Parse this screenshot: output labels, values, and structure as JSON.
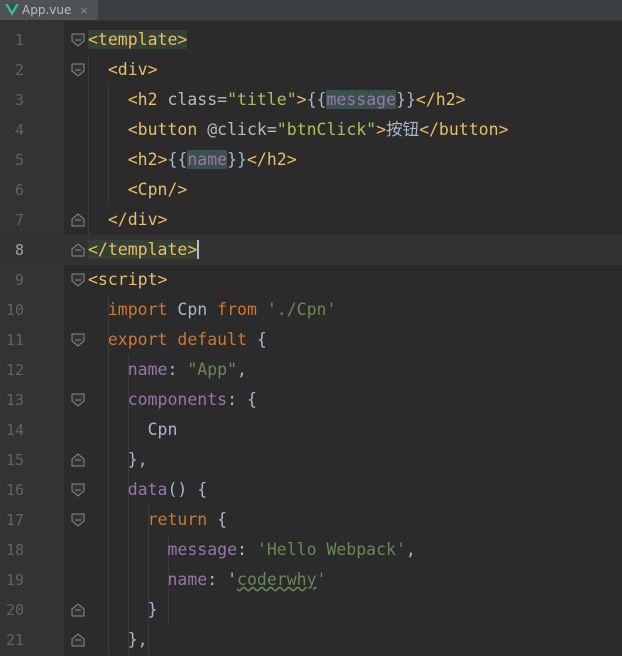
{
  "tab": {
    "filename": "App.vue",
    "close": "×"
  },
  "line_numbers": [
    "1",
    "2",
    "3",
    "4",
    "5",
    "6",
    "7",
    "8",
    "9",
    "10",
    "11",
    "12",
    "13",
    "14",
    "15",
    "16",
    "17",
    "18",
    "19",
    "20",
    "21"
  ],
  "lines": [
    [
      {
        "t": "<template>",
        "c": "tag hl"
      }
    ],
    [
      {
        "t": "  "
      },
      {
        "t": "<div>",
        "c": "tag"
      }
    ],
    [
      {
        "t": "    "
      },
      {
        "t": "<h2 ",
        "c": "tag"
      },
      {
        "t": "class=",
        "c": "attr"
      },
      {
        "t": "\"title\"",
        "c": "str"
      },
      {
        "t": ">",
        "c": "tag"
      },
      {
        "t": "{{"
      },
      {
        "t": "message",
        "c": "prop vhl"
      },
      {
        "t": "}}"
      },
      {
        "t": "</h2>",
        "c": "tag"
      }
    ],
    [
      {
        "t": "    "
      },
      {
        "t": "<button ",
        "c": "tag"
      },
      {
        "t": "@click=",
        "c": "attr"
      },
      {
        "t": "\"btnClick\"",
        "c": "str"
      },
      {
        "t": ">",
        "c": "tag"
      },
      {
        "t": "按钮"
      },
      {
        "t": "</button>",
        "c": "tag"
      }
    ],
    [
      {
        "t": "    "
      },
      {
        "t": "<h2>",
        "c": "tag"
      },
      {
        "t": "{{"
      },
      {
        "t": "name",
        "c": "prop vhl"
      },
      {
        "t": "}}"
      },
      {
        "t": "</h2>",
        "c": "tag"
      }
    ],
    [
      {
        "t": "    "
      },
      {
        "t": "<Cpn/>",
        "c": "tag"
      }
    ],
    [
      {
        "t": "  "
      },
      {
        "t": "</div>",
        "c": "tag"
      }
    ],
    [
      {
        "t": "</template>",
        "c": "tag hl"
      },
      {
        "t": "",
        "c": "caret"
      }
    ],
    [
      {
        "t": "<script>",
        "c": "tag"
      }
    ],
    [
      {
        "t": "  "
      },
      {
        "t": "import",
        "c": "kw"
      },
      {
        "t": " Cpn "
      },
      {
        "t": "from",
        "c": "kw"
      },
      {
        "t": " "
      },
      {
        "t": "'./Cpn'",
        "c": "jstr"
      }
    ],
    [
      {
        "t": "  "
      },
      {
        "t": "export",
        "c": "kw"
      },
      {
        "t": " "
      },
      {
        "t": "default",
        "c": "kw"
      },
      {
        "t": " {"
      }
    ],
    [
      {
        "t": "    "
      },
      {
        "t": "name",
        "c": "prop"
      },
      {
        "t": ": "
      },
      {
        "t": "\"App\"",
        "c": "jstr"
      },
      {
        "t": ","
      }
    ],
    [
      {
        "t": "    "
      },
      {
        "t": "components",
        "c": "prop"
      },
      {
        "t": ": {"
      }
    ],
    [
      {
        "t": "      Cpn"
      }
    ],
    [
      {
        "t": "    },"
      }
    ],
    [
      {
        "t": "    "
      },
      {
        "t": "data",
        "c": "prop"
      },
      {
        "t": "() {"
      }
    ],
    [
      {
        "t": "      "
      },
      {
        "t": "return",
        "c": "kw"
      },
      {
        "t": " {"
      }
    ],
    [
      {
        "t": "        "
      },
      {
        "t": "message",
        "c": "prop"
      },
      {
        "t": ": "
      },
      {
        "t": "'Hello Webpack'",
        "c": "jstr"
      },
      {
        "t": ","
      }
    ],
    [
      {
        "t": "        "
      },
      {
        "t": "name",
        "c": "prop"
      },
      {
        "t": ": "
      },
      {
        "t": "'"
      },
      {
        "t": "coderwhy",
        "c": "jstr squig"
      },
      {
        "t": "'",
        "c": "jstr"
      }
    ],
    [
      {
        "t": "      }"
      }
    ],
    [
      {
        "t": "    },"
      }
    ]
  ],
  "current_line": 8,
  "folds": [
    {
      "line": 1,
      "type": "open"
    },
    {
      "line": 2,
      "type": "open"
    },
    {
      "line": 7,
      "type": "close"
    },
    {
      "line": 8,
      "type": "close"
    },
    {
      "line": 9,
      "type": "open"
    },
    {
      "line": 11,
      "type": "open"
    },
    {
      "line": 13,
      "type": "open"
    },
    {
      "line": 15,
      "type": "close"
    },
    {
      "line": 16,
      "type": "open"
    },
    {
      "line": 17,
      "type": "open"
    },
    {
      "line": 20,
      "type": "close"
    },
    {
      "line": 21,
      "type": "close"
    }
  ],
  "colors": {
    "background": "#2b2b2b",
    "gutter": "#313335",
    "tag": "#e8bf6a",
    "keyword": "#cc7832",
    "string": "#6a8759",
    "property": "#9876aa"
  }
}
